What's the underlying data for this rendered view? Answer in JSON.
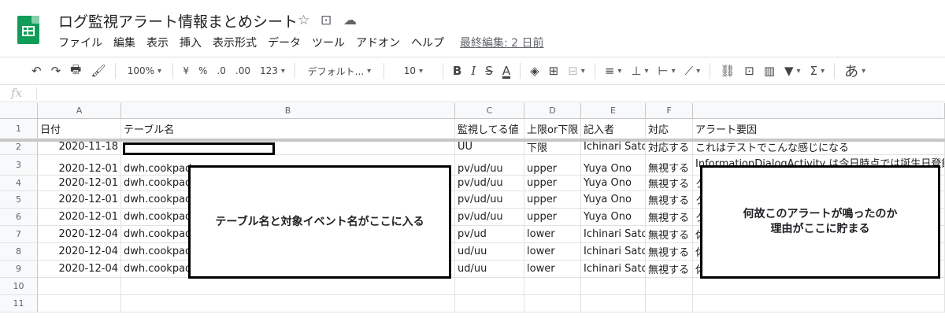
{
  "document": {
    "title": "ログ監視アラート情報まとめシート",
    "icons": [
      "star-icon",
      "move-to-folder-icon",
      "cloud-saved-icon"
    ]
  },
  "menu": {
    "items": [
      "ファイル",
      "編集",
      "表示",
      "挿入",
      "表示形式",
      "データ",
      "ツール",
      "アドオン",
      "ヘルプ"
    ],
    "last_edit": "最終編集: 2 日前"
  },
  "toolbar": {
    "undo": "↶",
    "redo": "↷",
    "print": "🖶",
    "paint_format": "🖌",
    "zoom": "100%",
    "currency": "¥",
    "percent": "%",
    "decimal_decrease": ".0",
    "decimal_increase": ".00",
    "more_formats": "123",
    "font": "デフォルト...",
    "font_size": "10",
    "bold": "B",
    "italic": "I",
    "strike": "S",
    "text_color": "A",
    "fill": "◈",
    "borders": "⊞",
    "merge": "⊟",
    "halign": "≡",
    "valign": "⊥",
    "wrap": "⊢",
    "rotate": "⟋",
    "link": "⛓",
    "comment": "⊡",
    "chart": "▥",
    "filter": "▼",
    "functions": "Σ",
    "input_tools": "あ"
  },
  "formula_bar": {
    "fx": "fx",
    "value": ""
  },
  "grid": {
    "column_letters": [
      "A",
      "B",
      "C",
      "D",
      "E",
      "F",
      ""
    ],
    "row_numbers": [
      "1",
      "2",
      "3",
      "4",
      "5",
      "6",
      "7",
      "8",
      "9",
      "10",
      "11"
    ],
    "header_row": [
      "日付",
      "テーブル名",
      "監視してる値",
      "上限or下限",
      "記入者",
      "対応",
      "アラート要因"
    ],
    "rows": [
      [
        "2020-11-18",
        "",
        "UU",
        "下限",
        "Ichinari Sato",
        "対応する",
        "これはテストでこんな感じになる"
      ],
      [
        "2020-12-01",
        "dwh.cookpad_",
        "pv/ud/uu",
        "upper",
        "Yuya Ono",
        "無視する",
        "InformationDialogActivity は今日時点では誕生日登録完"
      ],
      [
        "2020-12-01",
        "dwh.cookpad_",
        "pv/ud/uu",
        "upper",
        "Yuya Ono",
        "無視する",
        "ク"
      ],
      [
        "2020-12-01",
        "dwh.cookpad_",
        "pv/ud/uu",
        "upper",
        "Yuya Ono",
        "無視する",
        "ク"
      ],
      [
        "2020-12-01",
        "dwh.cookpad_",
        "pv/ud/uu",
        "upper",
        "Yuya Ono",
        "無視する",
        "ク"
      ],
      [
        "2020-12-04",
        "dwh.cookpad_",
        "pv/ud",
        "lower",
        "Ichinari Sato",
        "無視する",
        "休"
      ],
      [
        "2020-12-04",
        "dwh.cookpad_",
        "ud/uu",
        "lower",
        "Ichinari Sato",
        "無視する",
        "休"
      ],
      [
        "2020-12-04",
        "dwh.cookpad_app_view_stats_daily(HomeAll)",
        "ud/uu",
        "lower",
        "Ichinari Sato",
        "無視する",
        "休日明けに再度ログを確認したが特に"
      ],
      [
        "",
        "",
        "",
        "",
        "",
        "",
        ""
      ],
      [
        "",
        "",
        "",
        "",
        "",
        "",
        ""
      ]
    ]
  },
  "annotations": {
    "table_callout": "テーブル名と対象イベント名がここに入る",
    "reason_callout": "何故このアラートが鳴ったのか\n理由がここに貯まる"
  }
}
